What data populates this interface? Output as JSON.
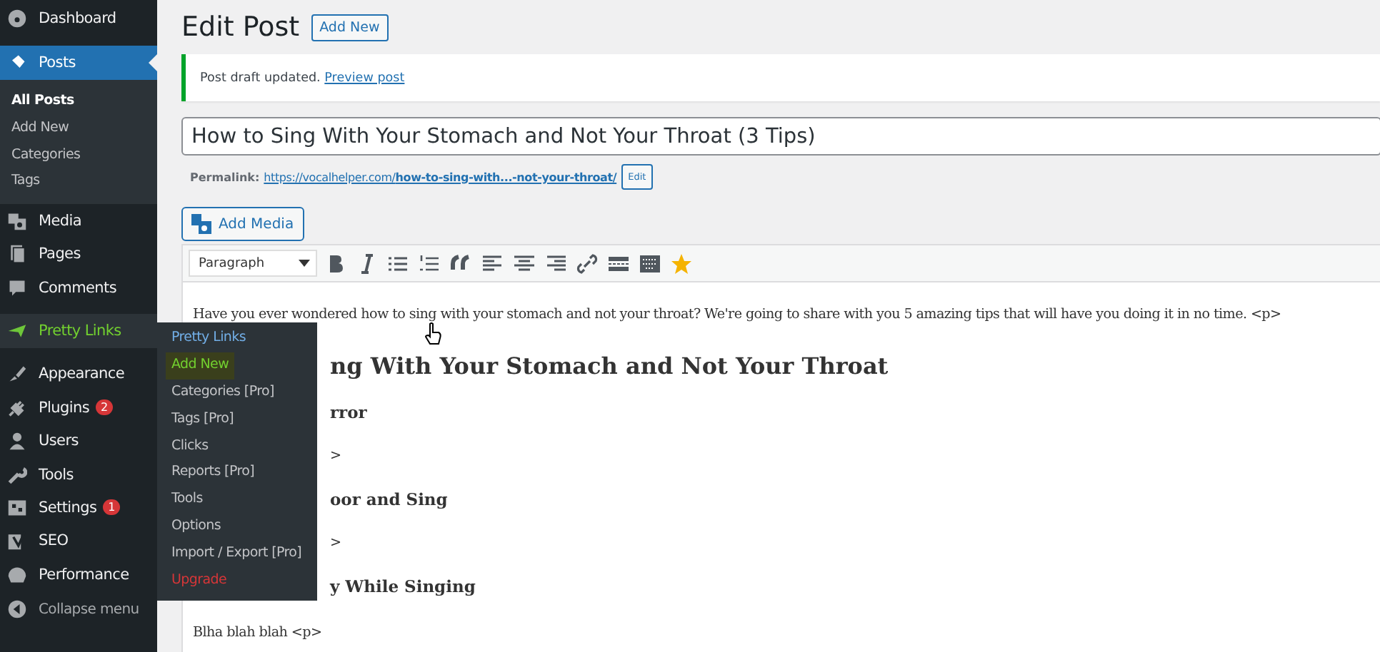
{
  "sidebar": {
    "items": [
      {
        "label": "Dashboard",
        "selected": false,
        "hover": false
      },
      {
        "label": "Posts",
        "selected": true,
        "hover": false,
        "children": [
          {
            "label": "All Posts",
            "selected": true
          },
          {
            "label": "Add New",
            "selected": false
          },
          {
            "label": "Categories",
            "selected": false
          },
          {
            "label": "Tags",
            "selected": false
          }
        ]
      },
      {
        "label": "Media",
        "selected": false,
        "hover": false
      },
      {
        "label": "Pages",
        "selected": false,
        "hover": false
      },
      {
        "label": "Comments",
        "selected": false,
        "hover": false
      },
      {
        "label": "Pretty Links",
        "selected": false,
        "hover": true
      },
      {
        "label": "Appearance",
        "selected": false,
        "hover": false
      },
      {
        "label": "Plugins",
        "selected": false,
        "hover": false,
        "badge": "2"
      },
      {
        "label": "Users",
        "selected": false,
        "hover": false
      },
      {
        "label": "Tools",
        "selected": false,
        "hover": false
      },
      {
        "label": "Settings",
        "selected": false,
        "hover": false,
        "badge": "1"
      },
      {
        "label": "SEO",
        "selected": false,
        "hover": false
      },
      {
        "label": "Performance",
        "selected": false,
        "hover": false
      },
      {
        "label": "Collapse menu",
        "selected": false,
        "hover": false
      }
    ]
  },
  "flyout": {
    "items": [
      {
        "label": "Pretty Links",
        "kind": "header",
        "selected": false
      },
      {
        "label": "Add New",
        "kind": "item",
        "selected": true
      },
      {
        "label": "Categories [Pro]",
        "kind": "item",
        "selected": false
      },
      {
        "label": "Tags [Pro]",
        "kind": "item",
        "selected": false
      },
      {
        "label": "Clicks",
        "kind": "item",
        "selected": false
      },
      {
        "label": "Reports [Pro]",
        "kind": "item",
        "selected": false
      },
      {
        "label": "Tools",
        "kind": "item",
        "selected": false
      },
      {
        "label": "Options",
        "kind": "item",
        "selected": false
      },
      {
        "label": "Import / Export [Pro]",
        "kind": "item",
        "selected": false
      },
      {
        "label": "Upgrade",
        "kind": "upgrade",
        "selected": false
      }
    ]
  },
  "page": {
    "title": "Edit Post",
    "add_new": "Add New"
  },
  "notice": {
    "text": "Post draft updated.",
    "link": "Preview post"
  },
  "post_title": {
    "value": "How to Sing With Your Stomach and Not Your Throat (3 Tips)"
  },
  "permalink": {
    "label": "Permalink:",
    "url_base": "https://vocalhelper.com/",
    "slug": "how-to-sing-with...-not-your-throat/",
    "edit": "Edit"
  },
  "add_media": "Add Media",
  "toolbar": {
    "format": "Paragraph"
  },
  "content": [
    {
      "kind": "p",
      "text": "Have you ever wondered how to sing with your stomach and not your throat? We're going to share with you 5 amazing tips that will have you doing it in no time. <p>"
    },
    {
      "kind": "h2",
      "text": "ng With Your Stomach and Not Your Throat",
      "covered": true
    },
    {
      "kind": "h3",
      "text": "rror",
      "covered": true
    },
    {
      "kind": "p",
      "text": ">",
      "covered": true
    },
    {
      "kind": "h3",
      "text": "oor and Sing",
      "covered": true
    },
    {
      "kind": "p",
      "text": ">",
      "covered": true
    },
    {
      "kind": "h3",
      "text": "y While Singing",
      "covered": true
    },
    {
      "kind": "p",
      "text": "Blha blah blah <p>"
    }
  ]
}
